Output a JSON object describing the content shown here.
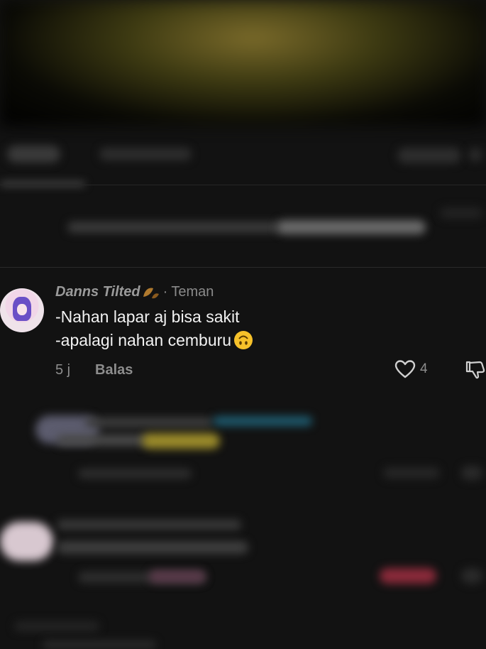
{
  "comment": {
    "username": "Danns Tilted",
    "relationship": "Teman",
    "separator": "·",
    "lines": [
      "-Nahan lapar aj bisa sakit",
      "-apalagi nahan cemburu"
    ],
    "time": "5 j",
    "reply_label": "Balas",
    "like_count": "4",
    "icons": {
      "avatar": "anime-avatar",
      "badge": "leaf-badge-icon",
      "emoji": "upside-down-face-emoji",
      "like": "heart-outline-icon",
      "dislike": "thumbs-down-icon"
    }
  },
  "colors": {
    "background": "#121212",
    "text_primary": "#f2f2f2",
    "text_secondary": "#8d8d8d"
  }
}
